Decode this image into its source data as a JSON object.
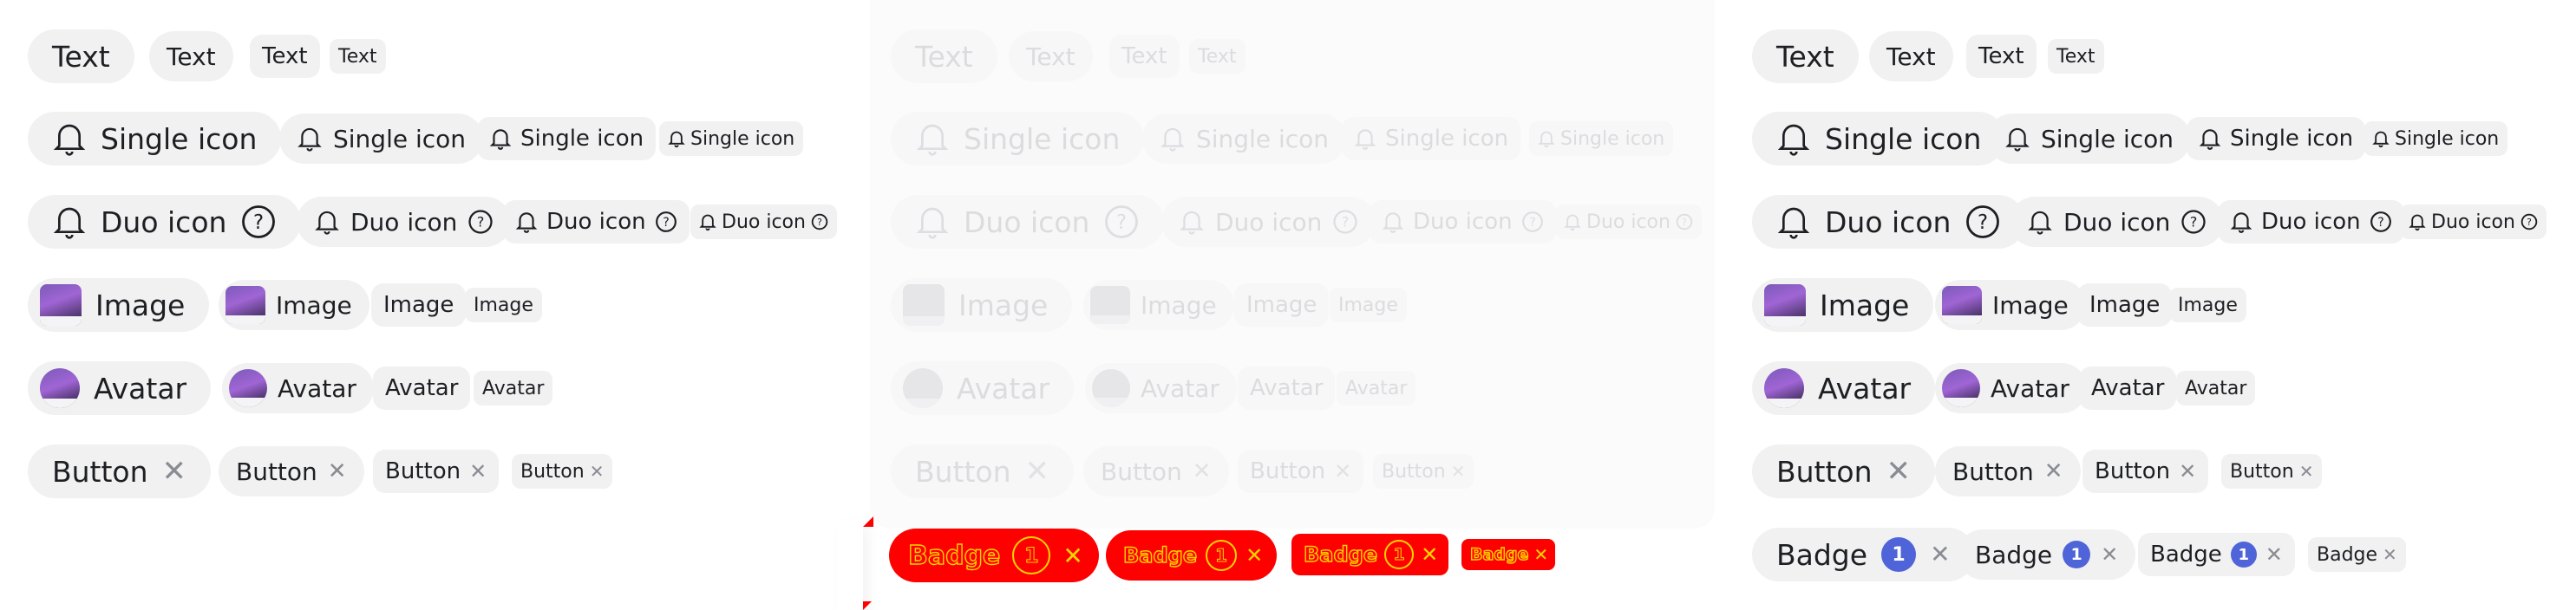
{
  "labels": {
    "text": "Text",
    "single_icon": "Single icon",
    "duo_icon": "Duo icon",
    "image": "Image",
    "avatar": "Avatar",
    "button": "Button",
    "badge": "Badge",
    "badge_count": "1",
    "close": "✕"
  },
  "panels": {
    "first": {
      "state": "default"
    },
    "second": {
      "state": "disabled",
      "badge_style": "error-highlight"
    },
    "third": {
      "state": "default"
    }
  },
  "colors": {
    "chip_bg": "#f1f1f2",
    "text": "#1e1f23",
    "badge_blue": "#4f64d8",
    "error_red": "#ff0000",
    "error_outline": "#ffd400",
    "disabled_text": "#dcdcdf"
  },
  "icons": [
    "bell-icon",
    "help-circle-icon",
    "close-icon"
  ]
}
